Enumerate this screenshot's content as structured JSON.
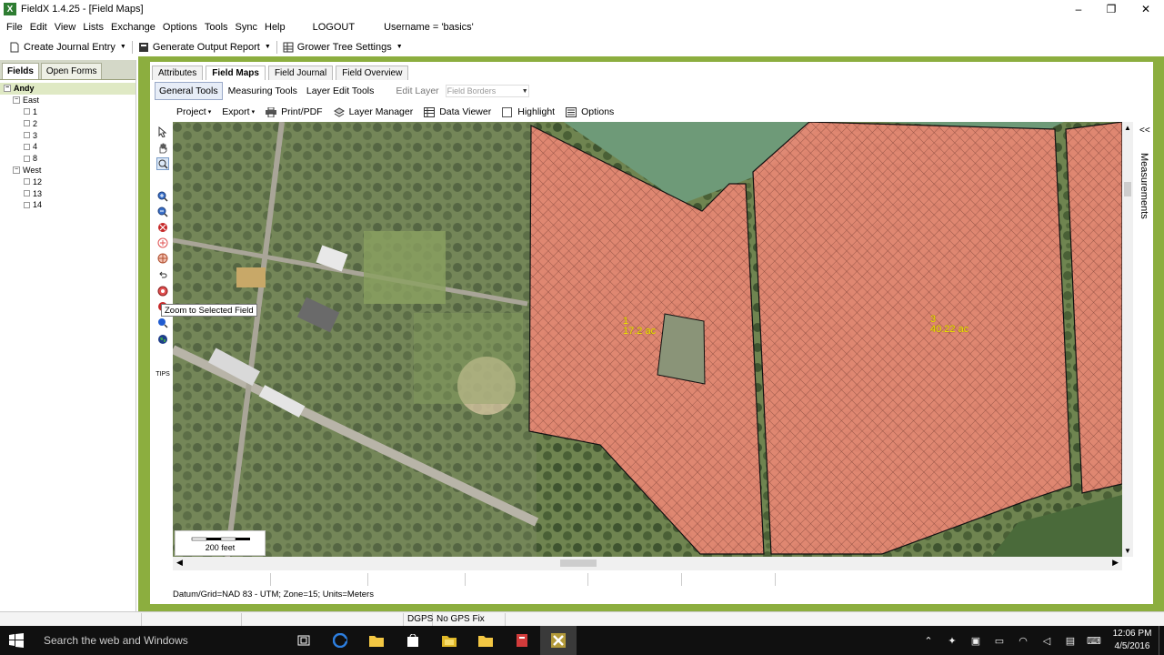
{
  "window": {
    "title": "FieldX 1.4.25 - [Field Maps]",
    "app_icon": "X",
    "minimize": "–",
    "maximize": "❐",
    "close": "✕"
  },
  "menu": {
    "items": [
      "File",
      "Edit",
      "View",
      "Lists",
      "Exchange",
      "Options",
      "Tools",
      "Sync",
      "Help"
    ],
    "logout": "LOGOUT",
    "username": "Username = 'basics'"
  },
  "toolbar": {
    "journal": "Create Journal Entry",
    "report": "Generate Output Report",
    "grower": "Grower Tree Settings"
  },
  "left_panel": {
    "tabs": [
      "Fields",
      "Open Forms"
    ],
    "tree": {
      "root": "Andy",
      "groups": [
        {
          "name": "East",
          "fields": [
            "1",
            "2",
            "3",
            "4",
            "8"
          ]
        },
        {
          "name": "West",
          "fields": [
            "12",
            "13",
            "14"
          ]
        }
      ]
    }
  },
  "doc_tabs": [
    "Attributes",
    "Field Maps",
    "Field Journal",
    "Field Overview"
  ],
  "sub_tabs": {
    "general": "General Tools",
    "measuring": "Measuring Tools",
    "layer_edit": "Layer Edit Tools",
    "edit_layer_label": "Edit Layer",
    "edit_layer_value": "Field Borders"
  },
  "map_toolbar": {
    "project": "Project",
    "export": "Export",
    "print": "Print/PDF",
    "layer_manager": "Layer Manager",
    "data_viewer": "Data Viewer",
    "highlight": "Highlight",
    "options": "Options"
  },
  "vertical_tools": {
    "tips": "TIPS",
    "icons": [
      "pointer-icon",
      "pan-hand-icon",
      "zoom-box-icon",
      "zoom-in-icon",
      "zoom-out-icon",
      "zoom-extent-icon",
      "add-point-icon",
      "gps-icon",
      "undo-icon",
      "zoom-selected-field-icon",
      "zoom-previous-icon",
      "search-icon",
      "globe-icon"
    ]
  },
  "map": {
    "fields": [
      {
        "number": "1",
        "area": "17.2 ac"
      },
      {
        "number": "3",
        "area": "40.22 ac"
      }
    ],
    "scale": "200 feet",
    "tooltip": "Zoom to Selected Field"
  },
  "measurements_panel": {
    "label": "Measurements",
    "collapse": "<<"
  },
  "status": {
    "datum": "Datum/Grid=NAD 83 - UTM; Zone=15; Units=Meters",
    "dgps": "DGPS",
    "gps": "No GPS Fix"
  },
  "taskbar": {
    "search": "Search the web and Windows",
    "time": "12:06 PM",
    "date": "4/5/2016"
  },
  "colors": {
    "accent_green": "#8cae3f",
    "field_fill": "#e88874",
    "field_label": "#f3e700"
  }
}
